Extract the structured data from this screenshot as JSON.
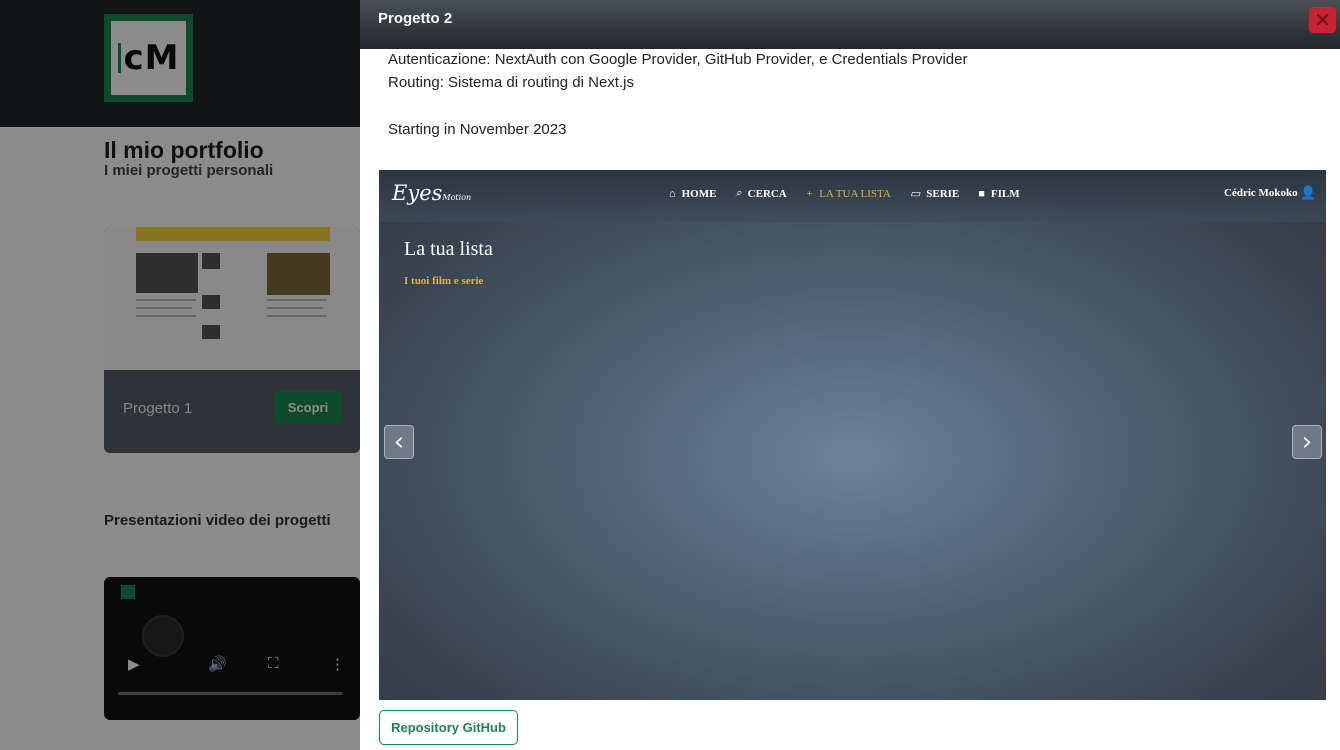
{
  "background": {
    "logo_text": "cM",
    "portfolio_title": "Il mio portfolio",
    "portfolio_subtitle": "I miei progetti personali",
    "card": {
      "label": "Progetto 1",
      "button": "Scopri"
    },
    "video_heading": "Presentazioni video dei progetti",
    "video_icons": {
      "play": "play-icon",
      "volume": "volume-icon",
      "fullscreen": "fullscreen-icon",
      "more": "more-icon"
    }
  },
  "modal": {
    "title": "Progetto 2",
    "close_icon": "close-icon",
    "description": [
      "Autenticazione: NextAuth con Google Provider, GitHub Provider, e Credentials Provider",
      "Routing: Sistema di routing di Next.js",
      "Starting in November 2023"
    ],
    "carousel": {
      "brand": "Eyes",
      "brand_small": "Motion",
      "menu": [
        {
          "label": "HOME",
          "icon": "home-icon"
        },
        {
          "label": "CERCA",
          "icon": "search-icon"
        },
        {
          "label": "LA TUA LISTA",
          "icon": "plus-icon"
        },
        {
          "label": "SERIE",
          "icon": "tv-icon"
        },
        {
          "label": "FILM",
          "icon": "camera-icon"
        }
      ],
      "user_name": "Cédric Mokoko",
      "user_icon": "user-icon",
      "heading": "La tua lista",
      "subheading": "I tuoi film e serie",
      "accent": "#e2b33a"
    },
    "repo_button": "Repository GitHub"
  },
  "colors": {
    "green": "#198754",
    "header_dark": "#212529",
    "close_red": "#c82333"
  }
}
